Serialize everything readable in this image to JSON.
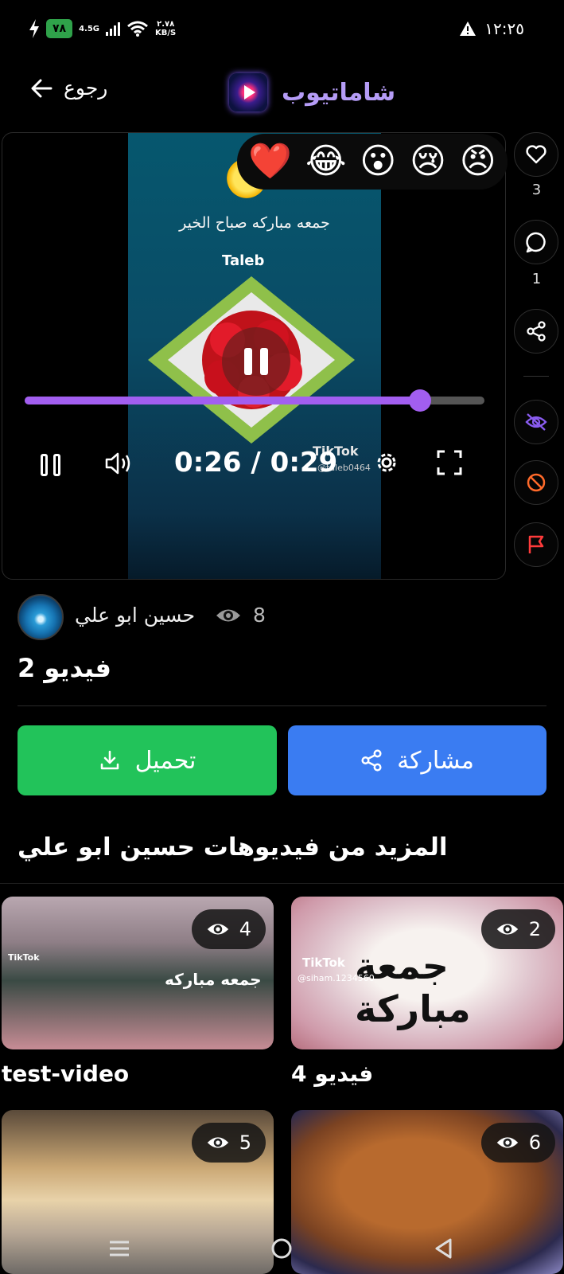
{
  "status_bar": {
    "battery": "٧٨",
    "network": "4.5G",
    "speed_value": "٢.٧٨",
    "speed_unit": "KB/S",
    "time": "١٢:٢٥"
  },
  "header": {
    "back_label": "رجوع",
    "app_name": "شاماتيوب"
  },
  "video": {
    "overlay_text": "جمعه مباركه صباح الخير",
    "overlay_name": "Taleb",
    "watermark": "TikTok",
    "watermark_handle": "@taleb0464",
    "time_display": "0:26 / 0:29",
    "progress_fraction": 0.86,
    "reactions": [
      "❤️",
      "😂",
      "😮",
      "😢",
      "😠"
    ]
  },
  "rail": {
    "likes_count": "3",
    "comments_count": "1"
  },
  "info": {
    "author": "حسين ابو علي",
    "views": "8",
    "title": "فيديو 2",
    "download_label": "تحميل",
    "share_label": "مشاركة",
    "more_title": "المزيد من فيديوهات حسين ابو علي"
  },
  "grid": [
    {
      "title": "test-video",
      "views": "4",
      "overlay": "جمعه مباركه",
      "watermark": "TikTok"
    },
    {
      "title": "فيديو 4",
      "views": "2",
      "overlay": "جمعة مباركة",
      "watermark": "TikTok",
      "handle": "@siham.1234560"
    },
    {
      "title": "",
      "views": "5"
    },
    {
      "title": "",
      "views": "6"
    }
  ],
  "colors": {
    "accent": "#a25ef0",
    "download": "#22c35a",
    "share": "#3a7cf2",
    "danger": "#ff5a3c"
  }
}
